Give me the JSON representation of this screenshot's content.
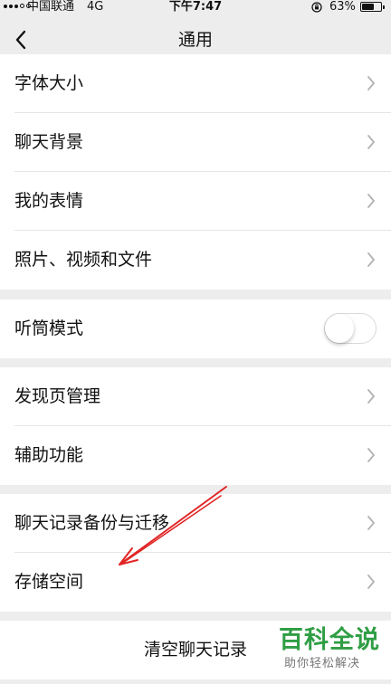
{
  "status_bar": {
    "carrier": "中国联通",
    "network": "4G",
    "time": "下午7:47",
    "battery_percent": "63%",
    "battery_level": 0.63
  },
  "nav": {
    "back_icon": "chevron-left-icon",
    "title": "通用"
  },
  "groups": [
    {
      "items": [
        {
          "label": "字体大小"
        },
        {
          "label": "聊天背景"
        },
        {
          "label": "我的表情"
        },
        {
          "label": "照片、视频和文件"
        }
      ]
    },
    {
      "items": [
        {
          "label": "听筒模式",
          "toggle": false
        }
      ]
    },
    {
      "items": [
        {
          "label": "发现页管理"
        },
        {
          "label": "辅助功能"
        }
      ]
    },
    {
      "items": [
        {
          "label": "聊天记录备份与迁移"
        },
        {
          "label": "存储空间"
        }
      ]
    }
  ],
  "clear_chat": {
    "label": "清空聊天记录"
  },
  "annotation": {
    "color": "#e02424"
  },
  "watermark": {
    "title": "百科全说",
    "subtitle": "助你轻松解决",
    "color": "#2f9e44"
  }
}
